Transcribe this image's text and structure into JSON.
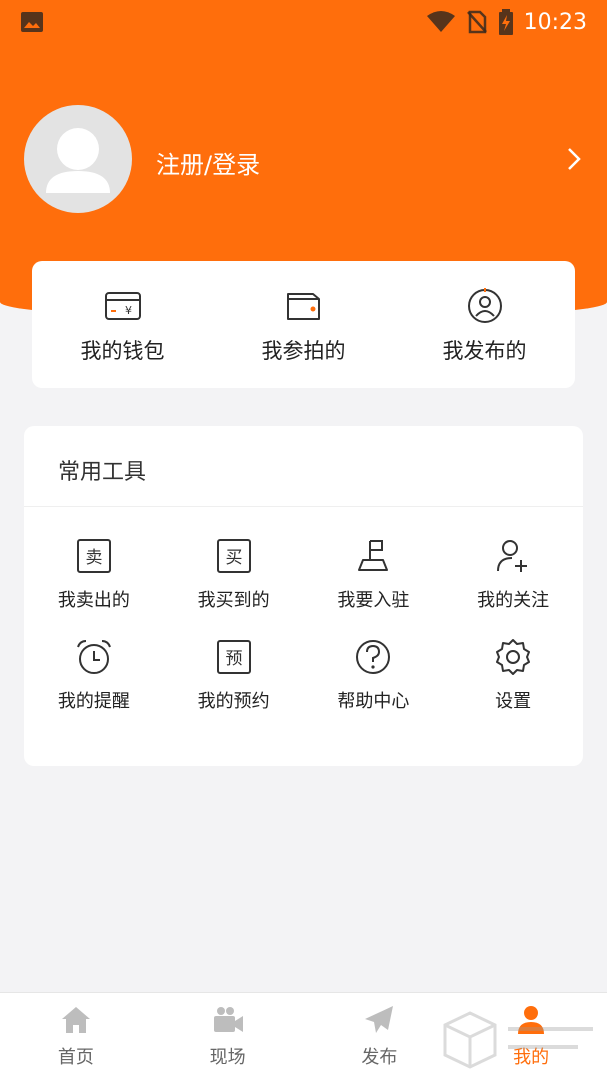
{
  "status_bar": {
    "time": "10:23",
    "icons": [
      "image-icon",
      "wifi-icon",
      "no-sim-icon",
      "battery-charging-icon"
    ]
  },
  "profile": {
    "login_label": "注册/登录",
    "avatar_icon": "default-avatar-icon",
    "arrow_icon": "chevron-right-icon"
  },
  "quick_actions": [
    {
      "label": "我的钱包",
      "icon": "wallet-card-icon"
    },
    {
      "label": "我参拍的",
      "icon": "folder-wallet-icon"
    },
    {
      "label": "我发布的",
      "icon": "user-circle-icon"
    }
  ],
  "tools": {
    "title": "常用工具",
    "items": [
      {
        "label": "我卖出的",
        "icon": "sell-box-icon",
        "glyph": "卖"
      },
      {
        "label": "我买到的",
        "icon": "buy-box-icon",
        "glyph": "买"
      },
      {
        "label": "我要入驻",
        "icon": "shop-flag-icon"
      },
      {
        "label": "我的关注",
        "icon": "user-plus-icon"
      },
      {
        "label": "我的提醒",
        "icon": "alarm-clock-icon"
      },
      {
        "label": "我的预约",
        "icon": "reserve-box-icon",
        "glyph": "预"
      },
      {
        "label": "帮助中心",
        "icon": "help-circle-icon"
      },
      {
        "label": "设置",
        "icon": "gear-icon"
      }
    ]
  },
  "tabbar": {
    "items": [
      {
        "label": "首页",
        "icon": "home-icon",
        "active": false
      },
      {
        "label": "现场",
        "icon": "video-camera-icon",
        "active": false
      },
      {
        "label": "发布",
        "icon": "paper-plane-icon",
        "active": false
      },
      {
        "label": "我的",
        "icon": "person-icon",
        "active": true
      }
    ]
  },
  "colors": {
    "brand": "#ff6e0c",
    "background": "#f3f3f5",
    "card": "#ffffff",
    "icon_stroke": "#333333",
    "tab_inactive": "#bdbdbd"
  }
}
